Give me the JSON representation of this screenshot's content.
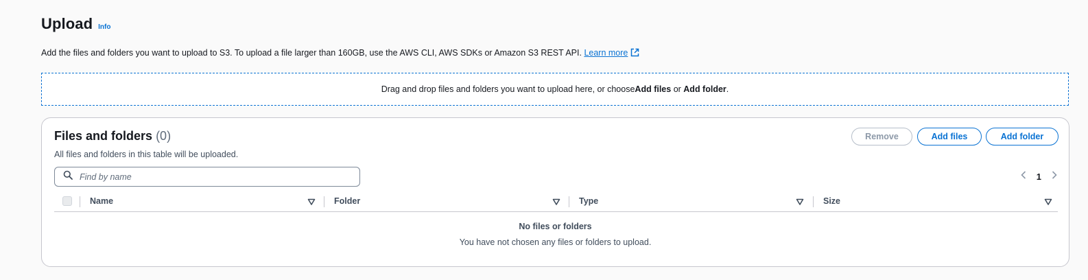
{
  "header": {
    "title": "Upload",
    "info_label": "Info"
  },
  "description": {
    "text": "Add the files and folders you want to upload to S3. To upload a file larger than 160GB, use the AWS CLI, AWS SDKs or Amazon S3 REST API.",
    "learn_more": "Learn more"
  },
  "dropzone": {
    "prefix": "Drag and drop files and folders you want to upload here, or choose ",
    "add_files": "Add files",
    "or": " or ",
    "add_folder": "Add folder",
    "suffix": "."
  },
  "panel": {
    "title": "Files and folders",
    "count": "(0)",
    "subtitle": "All files and folders in this table will be uploaded.",
    "buttons": {
      "remove": "Remove",
      "add_files": "Add files",
      "add_folder": "Add folder"
    },
    "search": {
      "placeholder": "Find by name",
      "icon": "search-icon"
    },
    "pagination": {
      "prev_icon": "chevron-left-icon",
      "page": "1",
      "next_icon": "chevron-right-icon"
    },
    "columns": [
      "Name",
      "Folder",
      "Type",
      "Size"
    ],
    "empty": {
      "title": "No files or folders",
      "message": "You have not chosen any files or folders to upload."
    }
  },
  "colors": {
    "accent": "#0972d3",
    "text": "#16191f",
    "muted": "#414d5c",
    "border": "#c6c6cd"
  }
}
